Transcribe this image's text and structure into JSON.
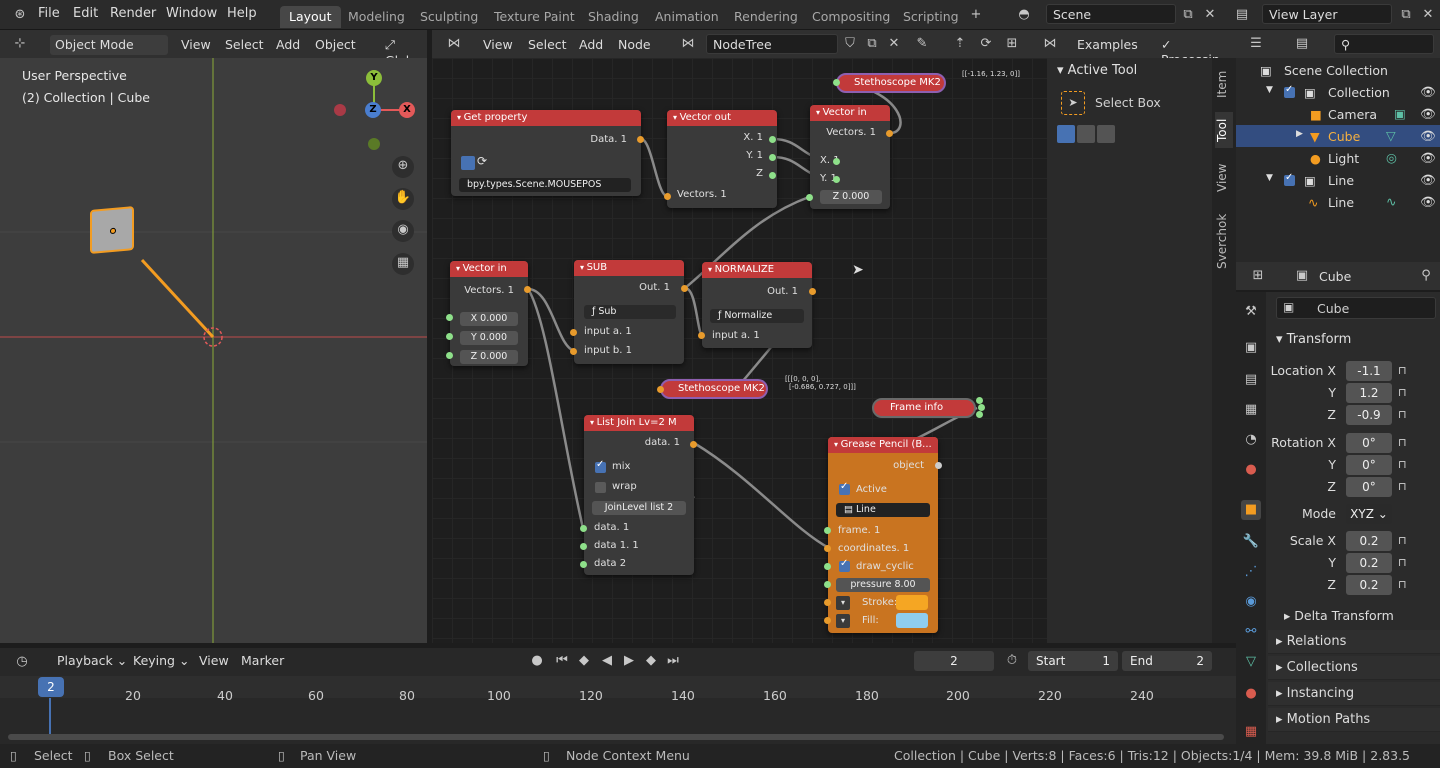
{
  "top_menu": {
    "file": "File",
    "edit": "Edit",
    "render": "Render",
    "window": "Window",
    "help": "Help"
  },
  "workspaces": [
    "Layout",
    "Modeling",
    "Sculpting",
    "Texture Paint",
    "Shading",
    "Animation",
    "Rendering",
    "Compositing",
    "Scripting"
  ],
  "scene": {
    "name": "Scene",
    "view_layer": "View Layer"
  },
  "viewport": {
    "mode": "Object Mode",
    "menus": [
      "View",
      "Select",
      "Add",
      "Object"
    ],
    "transform": "Glob",
    "title": "User Perspective",
    "subtitle": "(2) Collection | Cube",
    "axis": {
      "x": "X",
      "y": "Y",
      "z": "Z"
    }
  },
  "node_editor": {
    "menus": [
      "View",
      "Select",
      "Add",
      "Node"
    ],
    "tree": "NodeTree",
    "examples": "Examples",
    "processing": "Processin",
    "coords_top": "[[-1.16, 1.23, 0]]",
    "coords_mid_1": "[[[0, 0, 0],",
    "coords_mid_2": "[-0.686, 0.727, 0]]]",
    "nodes": {
      "get_property": {
        "title": "Get property",
        "out": "Data. 1",
        "path": "bpy.types.Scene.MOUSEPOS"
      },
      "vector_out": {
        "title": "Vector out",
        "x": "X. 1",
        "y": "Y. 1",
        "z": "Z",
        "in": "Vectors. 1"
      },
      "vector_in_top": {
        "title": "Vector in",
        "out": "Vectors. 1",
        "x": "X. 1",
        "y": "Y. 1",
        "z": "Z  0.000"
      },
      "stetho_top": "Stethoscope MK2",
      "vector_in_left": {
        "title": "Vector in",
        "out": "Vectors. 1",
        "x": "X  0.000",
        "y": "Y  0.000",
        "z": "Z  0.000"
      },
      "sub": {
        "title": "SUB",
        "out": "Out. 1",
        "op": "Sub",
        "a": "input a. 1",
        "b": "input b. 1"
      },
      "normalize": {
        "title": "NORMALIZE",
        "out": "Out. 1",
        "op": "Normalize",
        "a": "input a. 1"
      },
      "stetho_mid": "Stethoscope MK2",
      "list_join": {
        "title": "List Join Lv=2 M",
        "out": "data. 1",
        "mix": "mix",
        "wrap": "wrap",
        "level": "JoinLevel list   2",
        "d1": "data. 1",
        "d2": "data 1. 1",
        "d3": "data 2"
      },
      "frame_info": "Frame info",
      "grease": {
        "title": "Grease Pencil (B...",
        "object": "object",
        "active": "Active",
        "line": "Line",
        "frame": "frame. 1",
        "coords": "coordinates. 1",
        "cyclic": "draw_cyclic",
        "pressure": "pressure     8.00",
        "stroke": "Stroke:",
        "fill": "Fill:",
        "stroke_color": "#f5a623",
        "fill_color": "#8fcdf0"
      }
    }
  },
  "tool_panel": {
    "title": "Active Tool",
    "tool": "Select Box",
    "tabs": [
      "Item",
      "Tool",
      "View",
      "Sverchok"
    ]
  },
  "outliner": {
    "rows": [
      {
        "label": "Scene Collection"
      },
      {
        "label": "Collection"
      },
      {
        "label": "Camera"
      },
      {
        "label": "Cube"
      },
      {
        "label": "Light"
      },
      {
        "label": "Line"
      },
      {
        "label": "Line"
      }
    ]
  },
  "properties": {
    "object": "Cube",
    "name": "Cube",
    "transform": "Transform",
    "location_label": "Location X",
    "loc": [
      "-1.1",
      "1.2",
      "-0.9"
    ],
    "rotation_label": "Rotation X",
    "rot": [
      "0°",
      "0°",
      "0°"
    ],
    "mode_label": "Mode",
    "mode": "XYZ",
    "scale_label": "Scale X",
    "scale": [
      "0.2",
      "0.2",
      "0.2"
    ],
    "y": "Y",
    "z": "Z",
    "sections": [
      "Delta Transform",
      "Relations",
      "Collections",
      "Instancing",
      "Motion Paths"
    ]
  },
  "timeline": {
    "menus": [
      "Playback",
      "Keying",
      "View",
      "Marker"
    ],
    "current": "2",
    "start_label": "Start",
    "start": "1",
    "end_label": "End",
    "end": "2",
    "ticks": [
      "20",
      "40",
      "60",
      "80",
      "100",
      "120",
      "140",
      "160",
      "180",
      "200",
      "220",
      "240"
    ],
    "frame_marker": "2"
  },
  "status": {
    "select": "Select",
    "box_select": "Box Select",
    "pan": "Pan View",
    "context": "Node Context Menu",
    "stats": "Collection | Cube | Verts:8 | Faces:6 | Tris:12 | Objects:1/4 | Mem: 39.8 MiB | 2.83.5"
  }
}
